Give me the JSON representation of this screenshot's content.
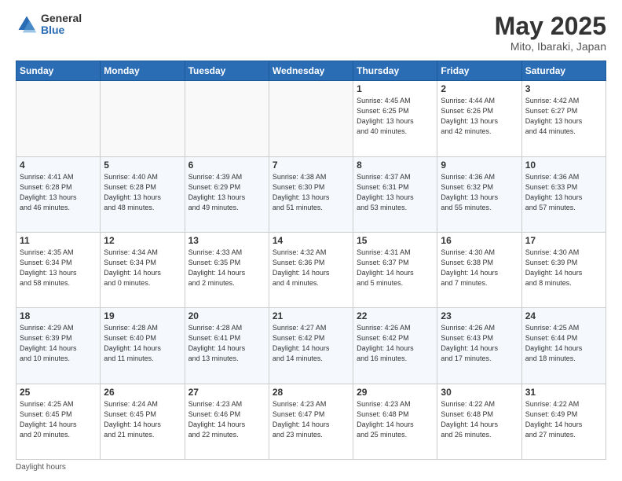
{
  "logo": {
    "general": "General",
    "blue": "Blue"
  },
  "title": "May 2025",
  "location": "Mito, Ibaraki, Japan",
  "days_of_week": [
    "Sunday",
    "Monday",
    "Tuesday",
    "Wednesday",
    "Thursday",
    "Friday",
    "Saturday"
  ],
  "footer": "Daylight hours",
  "weeks": [
    [
      {
        "day": "",
        "info": ""
      },
      {
        "day": "",
        "info": ""
      },
      {
        "day": "",
        "info": ""
      },
      {
        "day": "",
        "info": ""
      },
      {
        "day": "1",
        "info": "Sunrise: 4:45 AM\nSunset: 6:25 PM\nDaylight: 13 hours\nand 40 minutes."
      },
      {
        "day": "2",
        "info": "Sunrise: 4:44 AM\nSunset: 6:26 PM\nDaylight: 13 hours\nand 42 minutes."
      },
      {
        "day": "3",
        "info": "Sunrise: 4:42 AM\nSunset: 6:27 PM\nDaylight: 13 hours\nand 44 minutes."
      }
    ],
    [
      {
        "day": "4",
        "info": "Sunrise: 4:41 AM\nSunset: 6:28 PM\nDaylight: 13 hours\nand 46 minutes."
      },
      {
        "day": "5",
        "info": "Sunrise: 4:40 AM\nSunset: 6:28 PM\nDaylight: 13 hours\nand 48 minutes."
      },
      {
        "day": "6",
        "info": "Sunrise: 4:39 AM\nSunset: 6:29 PM\nDaylight: 13 hours\nand 49 minutes."
      },
      {
        "day": "7",
        "info": "Sunrise: 4:38 AM\nSunset: 6:30 PM\nDaylight: 13 hours\nand 51 minutes."
      },
      {
        "day": "8",
        "info": "Sunrise: 4:37 AM\nSunset: 6:31 PM\nDaylight: 13 hours\nand 53 minutes."
      },
      {
        "day": "9",
        "info": "Sunrise: 4:36 AM\nSunset: 6:32 PM\nDaylight: 13 hours\nand 55 minutes."
      },
      {
        "day": "10",
        "info": "Sunrise: 4:36 AM\nSunset: 6:33 PM\nDaylight: 13 hours\nand 57 minutes."
      }
    ],
    [
      {
        "day": "11",
        "info": "Sunrise: 4:35 AM\nSunset: 6:34 PM\nDaylight: 13 hours\nand 58 minutes."
      },
      {
        "day": "12",
        "info": "Sunrise: 4:34 AM\nSunset: 6:34 PM\nDaylight: 14 hours\nand 0 minutes."
      },
      {
        "day": "13",
        "info": "Sunrise: 4:33 AM\nSunset: 6:35 PM\nDaylight: 14 hours\nand 2 minutes."
      },
      {
        "day": "14",
        "info": "Sunrise: 4:32 AM\nSunset: 6:36 PM\nDaylight: 14 hours\nand 4 minutes."
      },
      {
        "day": "15",
        "info": "Sunrise: 4:31 AM\nSunset: 6:37 PM\nDaylight: 14 hours\nand 5 minutes."
      },
      {
        "day": "16",
        "info": "Sunrise: 4:30 AM\nSunset: 6:38 PM\nDaylight: 14 hours\nand 7 minutes."
      },
      {
        "day": "17",
        "info": "Sunrise: 4:30 AM\nSunset: 6:39 PM\nDaylight: 14 hours\nand 8 minutes."
      }
    ],
    [
      {
        "day": "18",
        "info": "Sunrise: 4:29 AM\nSunset: 6:39 PM\nDaylight: 14 hours\nand 10 minutes."
      },
      {
        "day": "19",
        "info": "Sunrise: 4:28 AM\nSunset: 6:40 PM\nDaylight: 14 hours\nand 11 minutes."
      },
      {
        "day": "20",
        "info": "Sunrise: 4:28 AM\nSunset: 6:41 PM\nDaylight: 14 hours\nand 13 minutes."
      },
      {
        "day": "21",
        "info": "Sunrise: 4:27 AM\nSunset: 6:42 PM\nDaylight: 14 hours\nand 14 minutes."
      },
      {
        "day": "22",
        "info": "Sunrise: 4:26 AM\nSunset: 6:42 PM\nDaylight: 14 hours\nand 16 minutes."
      },
      {
        "day": "23",
        "info": "Sunrise: 4:26 AM\nSunset: 6:43 PM\nDaylight: 14 hours\nand 17 minutes."
      },
      {
        "day": "24",
        "info": "Sunrise: 4:25 AM\nSunset: 6:44 PM\nDaylight: 14 hours\nand 18 minutes."
      }
    ],
    [
      {
        "day": "25",
        "info": "Sunrise: 4:25 AM\nSunset: 6:45 PM\nDaylight: 14 hours\nand 20 minutes."
      },
      {
        "day": "26",
        "info": "Sunrise: 4:24 AM\nSunset: 6:45 PM\nDaylight: 14 hours\nand 21 minutes."
      },
      {
        "day": "27",
        "info": "Sunrise: 4:23 AM\nSunset: 6:46 PM\nDaylight: 14 hours\nand 22 minutes."
      },
      {
        "day": "28",
        "info": "Sunrise: 4:23 AM\nSunset: 6:47 PM\nDaylight: 14 hours\nand 23 minutes."
      },
      {
        "day": "29",
        "info": "Sunrise: 4:23 AM\nSunset: 6:48 PM\nDaylight: 14 hours\nand 25 minutes."
      },
      {
        "day": "30",
        "info": "Sunrise: 4:22 AM\nSunset: 6:48 PM\nDaylight: 14 hours\nand 26 minutes."
      },
      {
        "day": "31",
        "info": "Sunrise: 4:22 AM\nSunset: 6:49 PM\nDaylight: 14 hours\nand 27 minutes."
      }
    ]
  ]
}
